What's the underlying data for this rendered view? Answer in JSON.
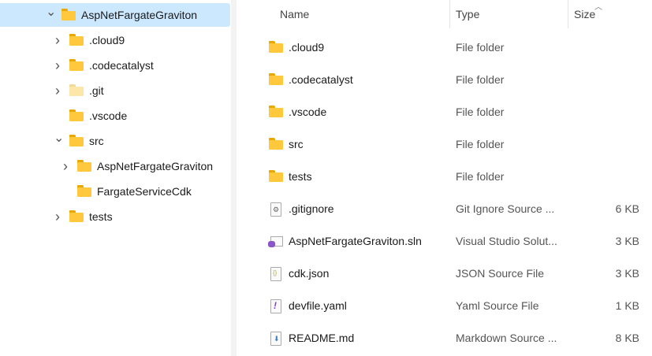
{
  "tree": [
    {
      "label": "AspNetFargateGraviton",
      "level": 0,
      "chevron": "down",
      "selected": true
    },
    {
      "label": ".cloud9",
      "level": 1,
      "chevron": "right"
    },
    {
      "label": ".codecatalyst",
      "level": 1,
      "chevron": "right"
    },
    {
      "label": ".git",
      "level": 1,
      "chevron": "right",
      "faded": true
    },
    {
      "label": ".vscode",
      "level": 1,
      "chevron": "none"
    },
    {
      "label": "src",
      "level": 1,
      "chevron": "down"
    },
    {
      "label": "AspNetFargateGraviton",
      "level": 2,
      "chevron": "right"
    },
    {
      "label": "FargateServiceCdk",
      "level": 2,
      "chevron": "none"
    },
    {
      "label": "tests",
      "level": 1,
      "chevron": "right"
    }
  ],
  "columns": {
    "name": "Name",
    "type": "Type",
    "size": "Size"
  },
  "files": [
    {
      "name": ".cloud9",
      "type": "File folder",
      "size": "",
      "icon": "folder-icon"
    },
    {
      "name": ".codecatalyst",
      "type": "File folder",
      "size": "",
      "icon": "folder-icon"
    },
    {
      "name": ".vscode",
      "type": "File folder",
      "size": "",
      "icon": "folder-icon"
    },
    {
      "name": "src",
      "type": "File folder",
      "size": "",
      "icon": "folder-icon"
    },
    {
      "name": "tests",
      "type": "File folder",
      "size": "",
      "icon": "folder-icon"
    },
    {
      "name": ".gitignore",
      "type": "Git Ignore Source ...",
      "size": "6 KB",
      "icon": "gear-file-icon"
    },
    {
      "name": "AspNetFargateGraviton.sln",
      "type": "Visual Studio Solut...",
      "size": "3 KB",
      "icon": "visual-studio-solution-icon"
    },
    {
      "name": "cdk.json",
      "type": "JSON Source File",
      "size": "3 KB",
      "icon": "json-file-icon"
    },
    {
      "name": "devfile.yaml",
      "type": "Yaml Source File",
      "size": "1 KB",
      "icon": "yaml-file-icon"
    },
    {
      "name": "README.md",
      "type": "Markdown Source ...",
      "size": "8 KB",
      "icon": "markdown-file-icon"
    }
  ]
}
